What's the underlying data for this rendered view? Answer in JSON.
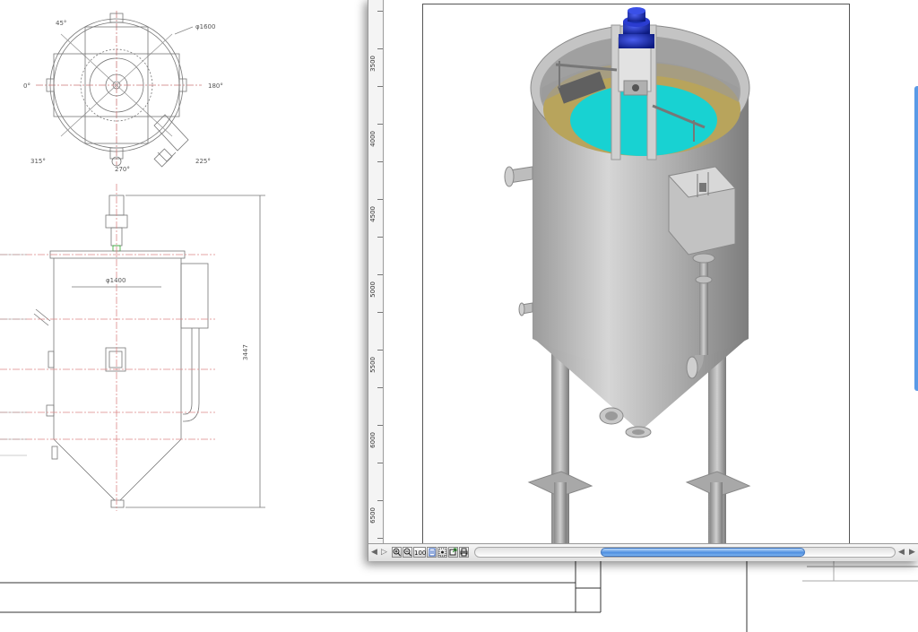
{
  "drawing": {
    "top_view": {
      "angle_45": "45°",
      "diameter": "φ1600",
      "angle_0": "0°",
      "angle_180": "180°",
      "angle_315": "315°",
      "angle_270": "270°",
      "angle_225": "225°"
    },
    "front_view": {
      "diameter": "φ1400",
      "height": "3447"
    }
  },
  "viewer": {
    "ruler_labels": [
      "3500",
      "4000",
      "4500",
      "5000",
      "5500",
      "6000",
      "6500"
    ],
    "statusbar": {
      "zoom_in_icon": "magnifier-plus",
      "zoom_out_icon": "magnifier-minus",
      "zoom_100_label": "100",
      "page_icon": "document",
      "fit_icon": "fit-page",
      "export_icon": "export",
      "print_icon": "print"
    },
    "colors": {
      "scroll_thumb": "#4e8fe0",
      "tank_body": "#b8b8b8",
      "liquid": "#18d2d2",
      "sludge_ring": "#b8a45c",
      "motor": "#1a2fb0"
    }
  }
}
